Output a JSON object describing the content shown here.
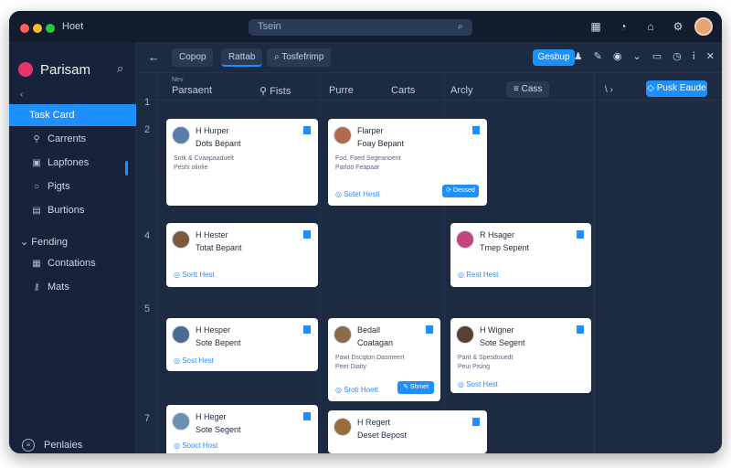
{
  "titlebar": {
    "app_name": "Hoet",
    "search_placeholder": "Tsein"
  },
  "sidebar": {
    "brand": "Parisam",
    "items": [
      {
        "label": "Task Card",
        "active": true
      },
      {
        "label": "Carrents"
      },
      {
        "label": "Lapfones"
      },
      {
        "label": "Pigts"
      },
      {
        "label": "Burtions"
      }
    ],
    "group": "Fending",
    "group_items": [
      {
        "label": "Contations"
      },
      {
        "label": "Mats"
      }
    ],
    "footer": "Penlaies"
  },
  "toolbar": {
    "tabs": [
      "Copop",
      "Rattab",
      "Tosfefrimp"
    ],
    "primary": "Gesbup",
    "right_action": "Pusk Eaude"
  },
  "columns": [
    "Nev",
    "Parsaent",
    "Fists",
    "Purre",
    "Carts",
    "Arcly",
    "Cass"
  ],
  "row_numbers": [
    "1",
    "2",
    "4",
    "5",
    "7"
  ],
  "cards": [
    {
      "name": "H Hurper",
      "role": "Dots Bepant",
      "lines": [
        "Sotk & Cvaapaaduelt",
        "Peshi olinlie"
      ],
      "link": "",
      "button": ""
    },
    {
      "name": "Flarper",
      "role": "Foay Bepant",
      "lines": [
        "Fod, Faed Segeanoent",
        "Parloo Feapaar"
      ],
      "link": "Sotet Hesti",
      "button": "Dessed"
    },
    {
      "name": "H Hester",
      "role": "Totat Bepant",
      "lines": [],
      "link": "Sortt Hest",
      "button": ""
    },
    {
      "name": "R Hsager",
      "role": "Tmep Sepent",
      "lines": [],
      "link": "Rest Hest",
      "button": ""
    },
    {
      "name": "H Hesper",
      "role": "Sote Bepent",
      "lines": [],
      "link": "Sost Hest",
      "button": ""
    },
    {
      "name": "Bedall",
      "role": "Coatagan",
      "lines": [
        "Pawt Dscqton Dasmeert",
        "Peet Diaity"
      ],
      "link": "Sroti Hoett",
      "button": "Shmet"
    },
    {
      "name": "H Wigner",
      "role": "Sote Segent",
      "lines": [
        "Pant & Spesdouedt",
        "Peui Pising"
      ],
      "link": "Sost Hest",
      "button": ""
    },
    {
      "name": "H Heger",
      "role": "Sote Segent",
      "lines": [],
      "link": "Sooct Host",
      "button": ""
    },
    {
      "name": "H Regert",
      "role": "Deset Bepost",
      "lines": [],
      "link": "",
      "button": ""
    }
  ]
}
